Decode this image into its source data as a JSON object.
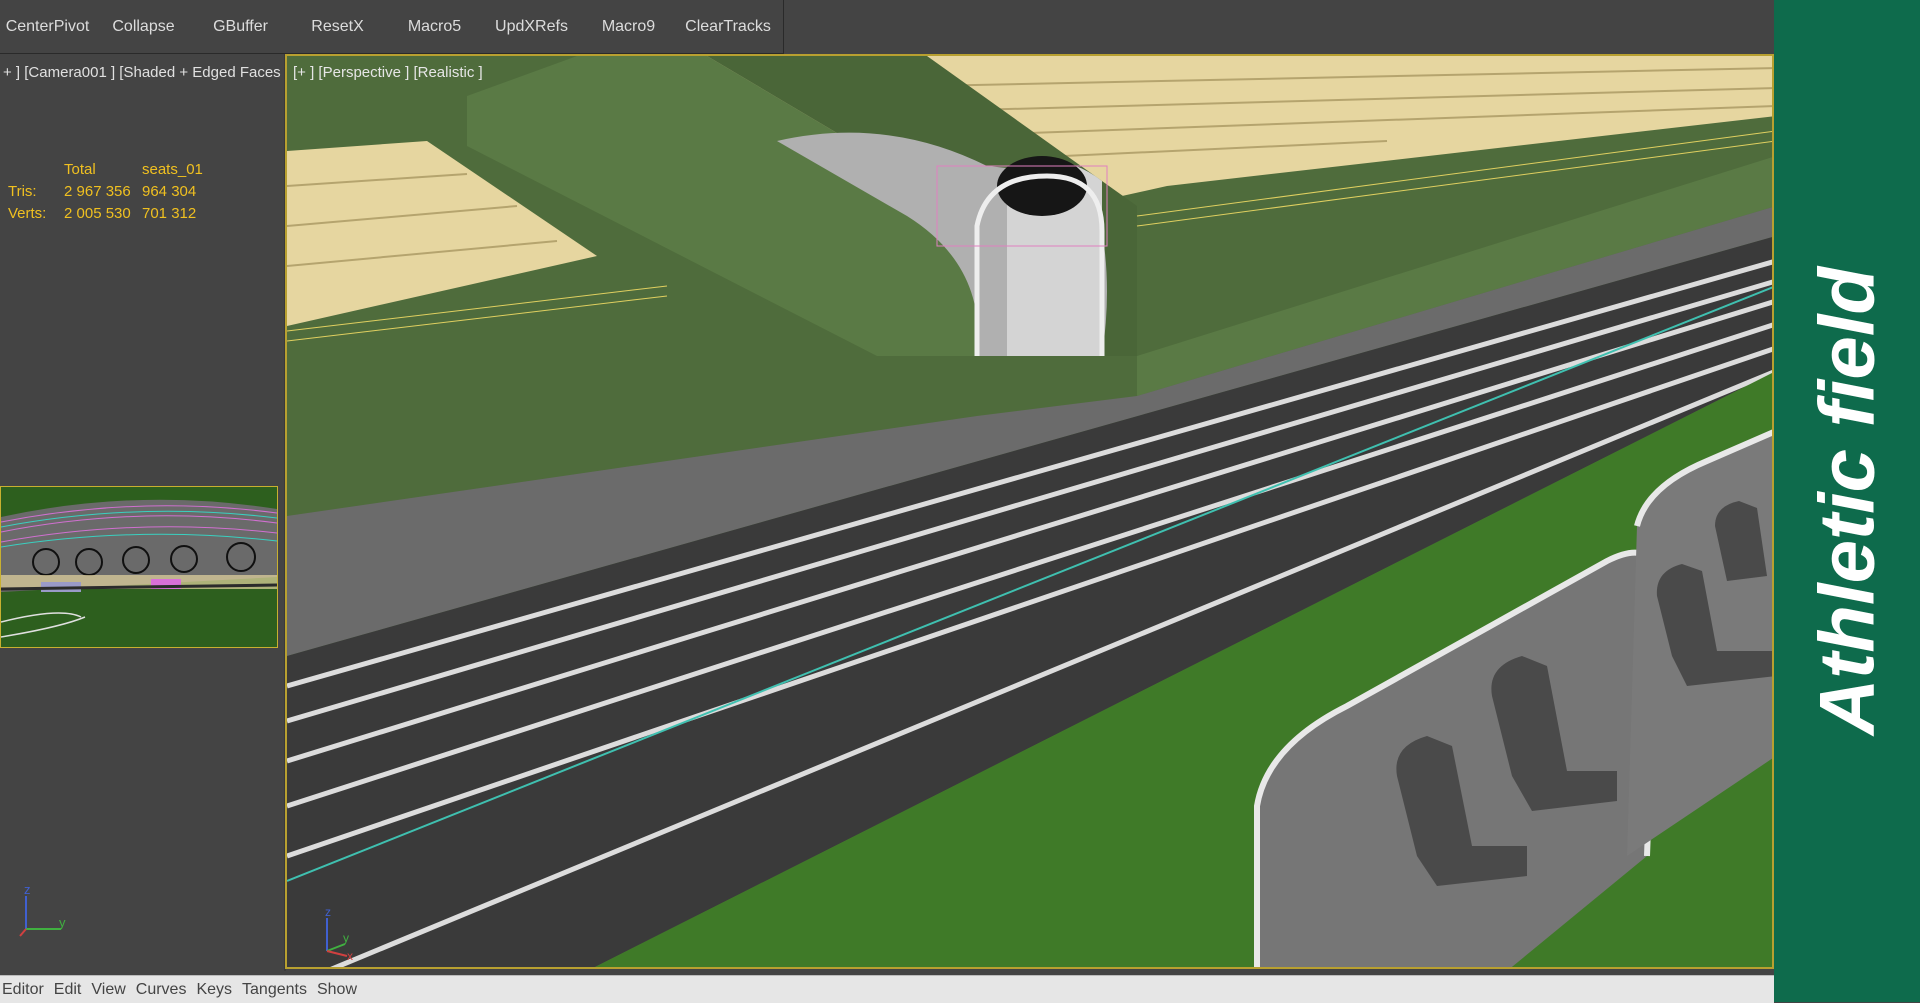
{
  "toolbar": {
    "buttons": [
      {
        "label": "CenterPivot"
      },
      {
        "label": "Collapse"
      },
      {
        "label": "GBuffer"
      },
      {
        "label": "ResetX"
      },
      {
        "label": "Macro5"
      },
      {
        "label": "UpdXRefs"
      },
      {
        "label": "Macro9"
      },
      {
        "label": "ClearTracks"
      }
    ]
  },
  "left_viewport": {
    "label": "+ ] [Camera001 ] [Shaded + Edged Faces ]",
    "stats": {
      "header_total": "Total",
      "header_object": "seats_01",
      "tris_label": "Tris:",
      "tris_total": "2 967 356",
      "tris_object": "964 304",
      "verts_label": "Verts:",
      "verts_total": "2 005 530",
      "verts_object": "701 312"
    },
    "axis": {
      "z": "z",
      "y": "y"
    }
  },
  "main_viewport": {
    "label": "[+ ] [Perspective ] [Realistic ]",
    "axis": {
      "z": "z",
      "y": "y",
      "x": "x"
    }
  },
  "bottom_menu": {
    "items": [
      "Editor",
      "Edit",
      "View",
      "Curves",
      "Keys",
      "Tangents",
      "Show"
    ]
  },
  "banner": {
    "text": "Athletic field",
    "color": "#0e6b4c"
  },
  "colors": {
    "viewport_border": "#b8a030",
    "stats_text": "#f0c020",
    "stand_wall": "#4d6b3a",
    "grass": "#3f7a28",
    "track": "#3b3b3b",
    "seat_yellow": "#e6d6a0"
  }
}
